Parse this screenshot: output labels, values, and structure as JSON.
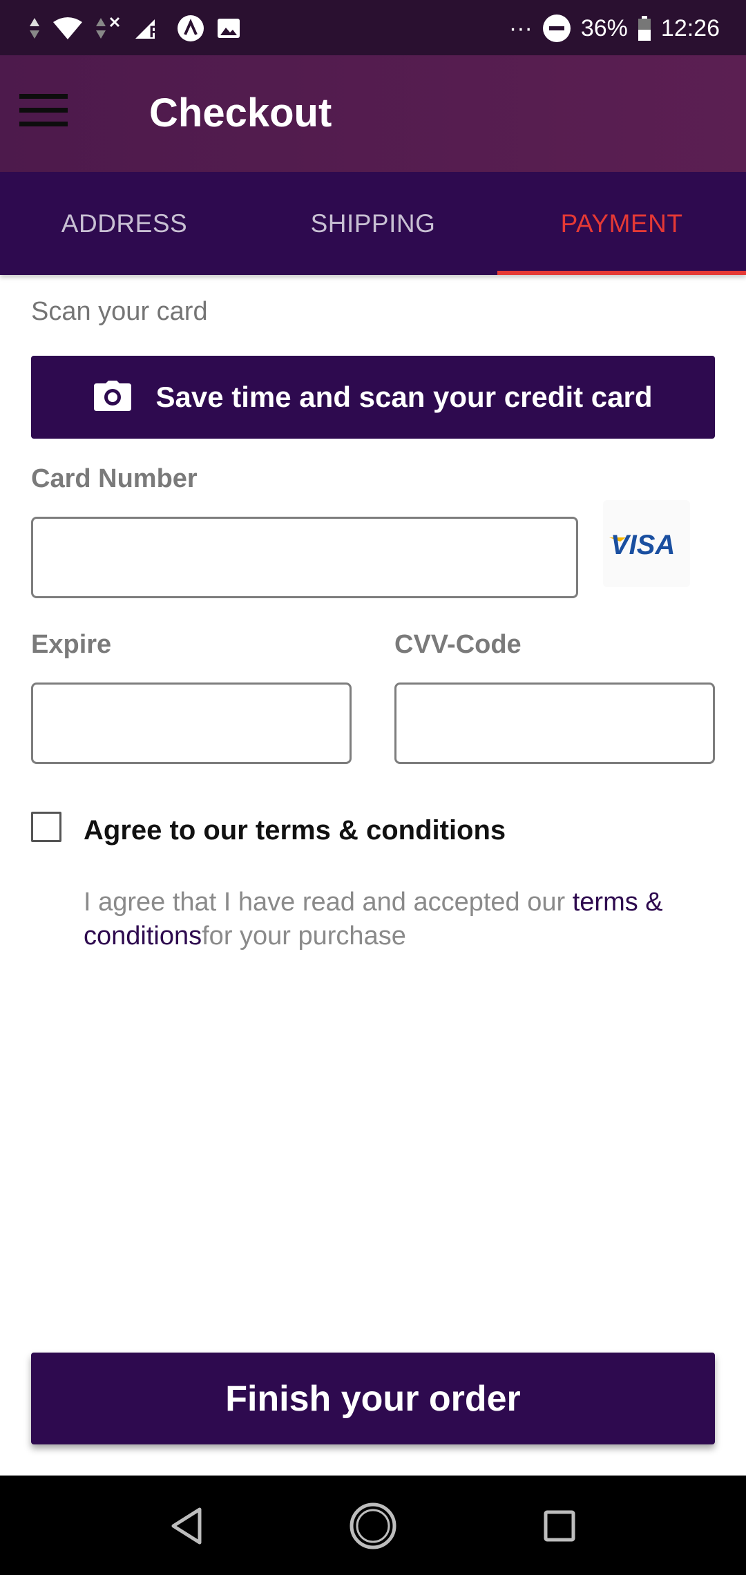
{
  "status_bar": {
    "battery_text": "36%",
    "time": "12:26",
    "overflow": "···"
  },
  "app_bar": {
    "title": "Checkout"
  },
  "tabs": [
    {
      "label": "ADDRESS",
      "active": false
    },
    {
      "label": "SHIPPING",
      "active": false
    },
    {
      "label": "PAYMENT",
      "active": true
    }
  ],
  "payment": {
    "scan_section_label": "Scan your card",
    "scan_button_label": "Save time and scan your credit card",
    "card_number_label": "Card Number",
    "card_number_value": "",
    "card_brand_logo": "VISA",
    "expire_label": "Expire",
    "expire_value": "",
    "cvv_label": "CVV-Code",
    "cvv_value": "",
    "terms": {
      "checked": false,
      "heading": "Agree to our terms & conditions",
      "text_before": "I agree that I have read and accepted our ",
      "link_text": "terms & conditions",
      "text_after": "for your purchase"
    },
    "finish_button_label": "Finish your order"
  },
  "colors": {
    "primary": "#2e0a4f",
    "app_bar": "#561c50",
    "tab_active": "#e53935",
    "status_bar": "#2a1030"
  },
  "icons": {
    "menu": "hamburger-menu-icon",
    "camera": "camera-icon",
    "nav_back": "back-triangle-icon",
    "nav_home": "home-circle-icon",
    "nav_recents": "recents-square-icon"
  }
}
